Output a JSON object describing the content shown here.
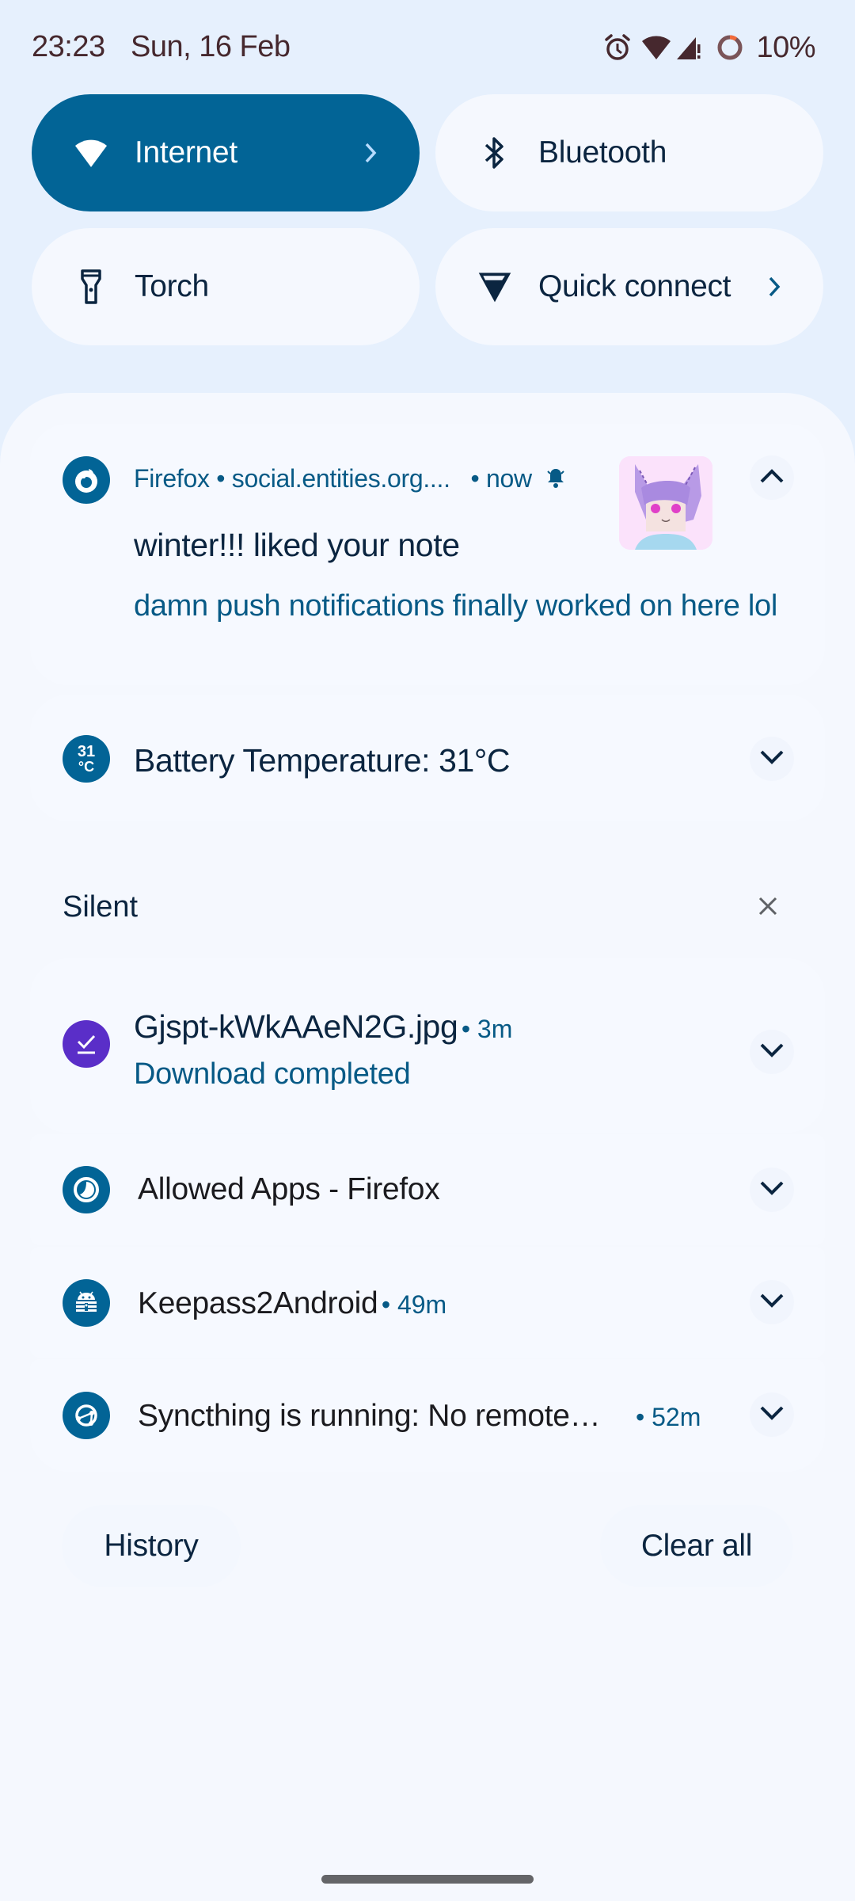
{
  "status_bar": {
    "time": "23:23",
    "date": "Sun, 16 Feb",
    "icons": [
      "alarm-icon",
      "wifi-icon",
      "cellular-no-signal-icon",
      "battery-ring-icon"
    ],
    "battery_percent": "10%"
  },
  "quick_tiles": [
    {
      "label": "Internet",
      "icon": "wifi-icon",
      "active": true,
      "has_chevron": true
    },
    {
      "label": "Bluetooth",
      "icon": "bluetooth-icon",
      "active": false,
      "has_chevron": false
    },
    {
      "label": "Torch",
      "icon": "flashlight-icon",
      "active": false,
      "has_chevron": false
    },
    {
      "label": "Quick connect",
      "icon": "vpn-icon",
      "active": false,
      "has_chevron": true
    }
  ],
  "notifications": {
    "firefox": {
      "app": "Firefox",
      "source": "social.entities.org....",
      "time": "now",
      "title": "winter!!! liked your note",
      "body": "damn push notifications finally worked on here lol"
    },
    "battery": {
      "icon_text_top": "31",
      "icon_text_bottom": "°C",
      "title": "Battery Temperature: 31°C"
    },
    "silent_section": {
      "label": "Silent"
    },
    "download": {
      "title": "Gjspt-kWkAAeN2G.jpg",
      "time": "3m",
      "body": "Download completed"
    },
    "allowed_apps": {
      "title": "Allowed Apps - Firefox"
    },
    "keepass": {
      "title": "Keepass2Android",
      "time": "49m"
    },
    "syncthing": {
      "title": "Syncthing is running: No remote…",
      "time": "52m"
    }
  },
  "footer": {
    "history_label": "History",
    "clear_all_label": "Clear all"
  },
  "colors": {
    "accent": "#026496",
    "background": "#e6f0fd",
    "shade": "#f5f8fe",
    "download_icon": "#5a2ec8"
  }
}
